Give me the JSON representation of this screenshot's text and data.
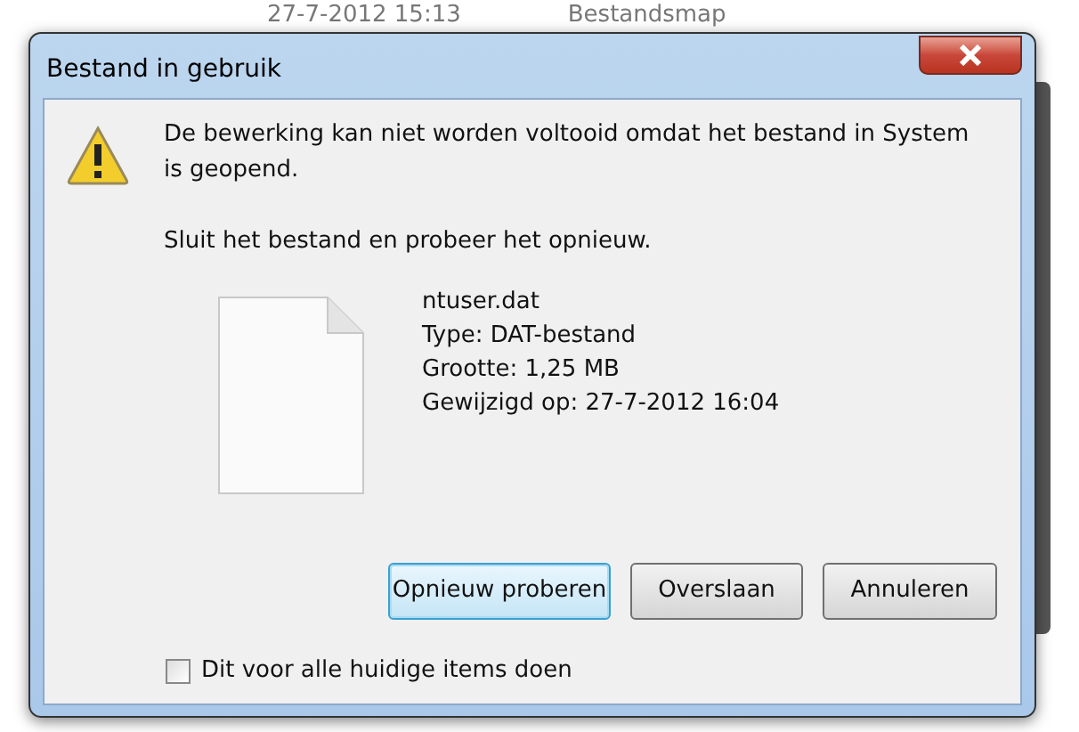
{
  "background": {
    "date": "27-7-2012 15:13",
    "type": "Bestandsmap"
  },
  "window": {
    "title": "Bestand in gebruik"
  },
  "message": "De bewerking kan niet worden voltooid omdat het bestand in System is geopend.",
  "instruction": "Sluit het bestand en probeer het opnieuw.",
  "file": {
    "name": "ntuser.dat",
    "details": [
      "Type: DAT-bestand",
      "Grootte: 1,25 MB",
      "Gewijzigd op: 27-7-2012 16:04"
    ]
  },
  "buttons": [
    {
      "label": "Opnieuw proberen",
      "selected": true
    },
    {
      "label": "Overslaan",
      "selected": false
    },
    {
      "label": "Annuleren",
      "selected": false
    }
  ],
  "apply_all": {
    "label": "Dit voor alle huidige items doen",
    "checked": false
  }
}
